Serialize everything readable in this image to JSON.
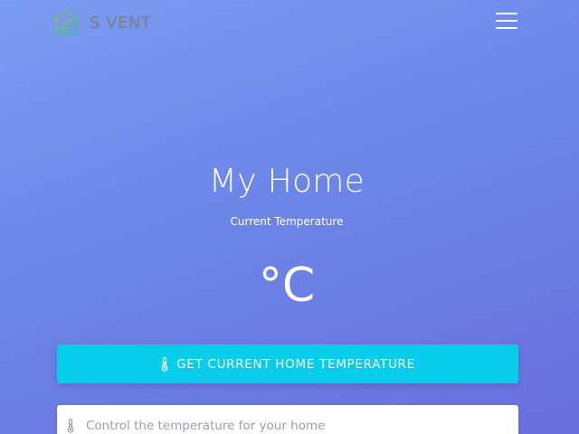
{
  "navbar": {
    "brand_text": "S VENT",
    "brand_logo_icon": "house-leaf-icon",
    "menu_icon": "hamburger-menu-icon"
  },
  "hero": {
    "title": "My Home",
    "subtitle": "Current Temperature",
    "temperature_unit": "°C"
  },
  "actions": {
    "get_temp_button_label": "GET CURRENT HOME TEMPERATURE",
    "get_temp_button_icon": "thermometer-icon"
  },
  "control": {
    "input_icon": "thermometer-icon",
    "input_placeholder": "Control the temperature for your home",
    "input_value": ""
  },
  "colors": {
    "background_top": "#7b9cf2",
    "background_bottom": "#6a6fde",
    "button_accent": "#06cde9",
    "logo_green": "#8cc63f",
    "logo_teal": "#3ab6b0",
    "brand_text": "#7b7f86"
  }
}
